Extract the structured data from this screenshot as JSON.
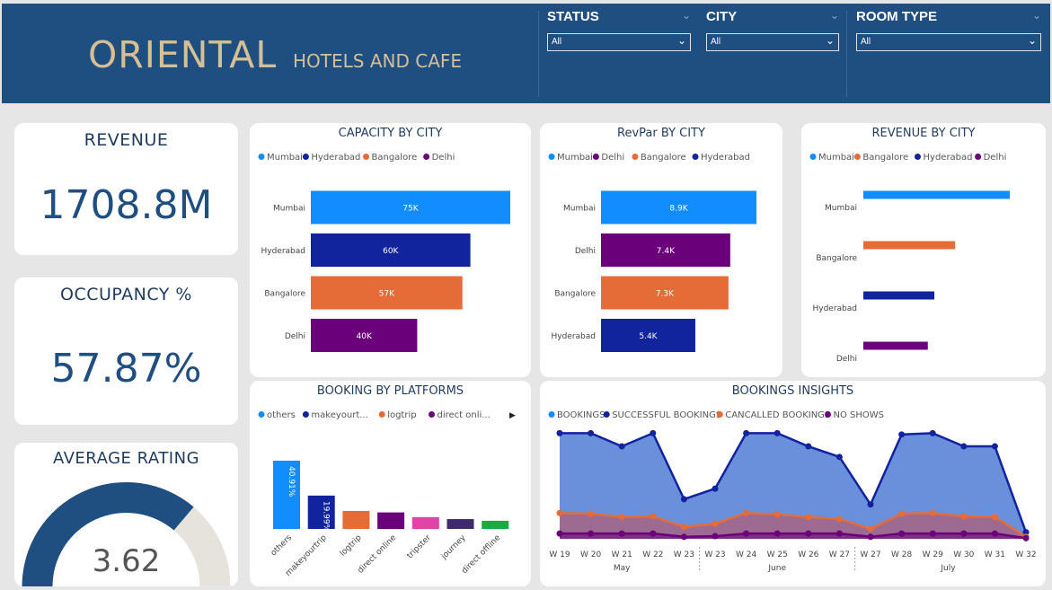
{
  "header": {
    "title": "ORIENTAL",
    "subtitle": "HOTELS AND CAFE",
    "background": "#1f4e80",
    "accent": "#d6bf95"
  },
  "slicers": [
    {
      "label": "STATUS",
      "value": "All",
      "icon": "chevron-down-icon"
    },
    {
      "label": "CITY",
      "value": "All",
      "icon": "chevron-down-icon"
    },
    {
      "label": "ROOM TYPE",
      "value": "All",
      "icon": "chevron-down-icon"
    }
  ],
  "kpis": {
    "revenue": {
      "label": "REVENUE",
      "value": "1708.8M"
    },
    "occupancy": {
      "label": "OCCUPANCY %",
      "value": "57.87%"
    },
    "rating": {
      "label": "AVERAGE RATING",
      "value": "3.62",
      "max": 5
    }
  },
  "colors": {
    "Mumbai": "#118dff",
    "Hyderabad": "#12239e",
    "Bangalore": "#e66c37",
    "Delhi": "#6b007b",
    "tripster": "#e044a7",
    "journey": "#3f2a6e",
    "direct offline": "#1aab40",
    "gauge_fill": "#1f4e80",
    "gauge_bg": "#e6e2dc"
  },
  "chart_data": [
    {
      "id": "capacity",
      "type": "bar",
      "orientation": "horizontal",
      "title": "CAPACITY BY CITY",
      "legend": [
        "Mumbai",
        "Hyderabad",
        "Bangalore",
        "Delhi"
      ],
      "categories": [
        "Mumbai",
        "Hyderabad",
        "Bangalore",
        "Delhi"
      ],
      "values": [
        75000,
        60000,
        57000,
        40000
      ],
      "data_labels": [
        "75K",
        "60K",
        "57K",
        "40K"
      ]
    },
    {
      "id": "revpar",
      "type": "bar",
      "orientation": "horizontal",
      "title": "RevPar BY CITY",
      "legend": [
        "Mumbai",
        "Delhi",
        "Bangalore",
        "Hyderabad"
      ],
      "categories": [
        "Mumbai",
        "Delhi",
        "Bangalore",
        "Hyderabad"
      ],
      "values": [
        8900,
        7400,
        7300,
        5400
      ],
      "data_labels": [
        "8.9K",
        "7.4K",
        "7.3K",
        "5.4K"
      ]
    },
    {
      "id": "revenue_city",
      "type": "bar",
      "orientation": "horizontal",
      "title": "REVENUE BY CITY",
      "legend": [
        "Mumbai",
        "Bangalore",
        "Hyderabad",
        "Delhi"
      ],
      "categories": [
        "Mumbai",
        "Bangalore",
        "Hyderabad",
        "Delhi"
      ],
      "values": [
        670,
        420,
        325,
        295
      ]
    },
    {
      "id": "platforms",
      "type": "bar",
      "title": "BOOKING BY PLATFORMS",
      "legend": [
        "others",
        "makeyourt...",
        "logtrip",
        "direct onli...",
        "tripster"
      ],
      "categories": [
        "others",
        "makeyourtrip",
        "logtrip",
        "direct online",
        "tripster",
        "journey",
        "direct offline"
      ],
      "values": [
        40.91,
        19.99,
        10.8,
        9.9,
        7.1,
        5.9,
        4.9
      ],
      "data_labels": [
        "40.91%",
        "19.99%",
        "",
        "",
        "",
        "",
        ""
      ],
      "legend_colors": [
        "#118dff",
        "#12239e",
        "#e66c37",
        "#6b007b",
        "#e044a7"
      ],
      "bar_colors": [
        "#118dff",
        "#12239e",
        "#e66c37",
        "#6b007b",
        "#e044a7",
        "#3f2a6e",
        "#1aab40"
      ]
    },
    {
      "id": "insights",
      "type": "area",
      "title": "BOOKINGS INSIGHTS",
      "x": [
        "W 19",
        "W 20",
        "W 21",
        "W 22",
        "W 23",
        "W 23",
        "W 24",
        "W 25",
        "W 26",
        "W 27",
        "W 27",
        "W 28",
        "W 29",
        "W 30",
        "W 31",
        "W 32"
      ],
      "months": [
        "May",
        "June",
        "July"
      ],
      "series": [
        {
          "name": "BOOKINGS",
          "color": "#118dff",
          "values": [
            8000,
            8000,
            7000,
            8000,
            3000,
            3800,
            8000,
            8000,
            7000,
            6200,
            2600,
            7900,
            8000,
            7000,
            7000,
            500
          ]
        },
        {
          "name": "SUCCESSFUL BOOKINGS",
          "color": "#12239e",
          "values": [
            8000,
            8000,
            7000,
            8000,
            3000,
            3800,
            8000,
            8000,
            7000,
            6200,
            2600,
            7900,
            8000,
            7000,
            7000,
            500
          ]
        },
        {
          "name": "CANCALLED BOOKINGS",
          "color": "#e66c37",
          "values": [
            1950,
            1900,
            1650,
            1700,
            900,
            1150,
            1950,
            1850,
            1650,
            1500,
            750,
            1900,
            1950,
            1700,
            1650,
            150
          ]
        },
        {
          "name": "NO SHOWS",
          "color": "#6b007b",
          "values": [
            400,
            400,
            400,
            400,
            150,
            200,
            400,
            400,
            400,
            400,
            150,
            400,
            400,
            400,
            400,
            50
          ]
        }
      ],
      "ylim": [
        0,
        8500
      ]
    }
  ]
}
